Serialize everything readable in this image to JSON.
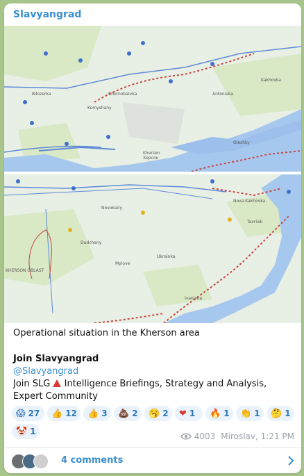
{
  "channel": {
    "name": "Slavyangrad"
  },
  "map1": {
    "labels": [
      "Kherson",
      "Херсон",
      "Antonivka",
      "Komyshany",
      "Chornobaivka",
      "Bilozerka",
      "Oleshky",
      "Kakhovka"
    ],
    "colors": {
      "water": "#a6c8ee",
      "land": "#e8efe4",
      "field": "#d5e6bd",
      "front": "#c9443f"
    }
  },
  "map2": {
    "labels": [
      "Novokairy",
      "Dudchany",
      "Mylove",
      "Nova Kakhovka",
      "Tavriisk",
      "Ukrainka",
      "Ivanivka",
      "KHERSON OBLAST"
    ],
    "colors": {
      "water": "#a6c8ee",
      "land": "#e8efe4",
      "field": "#d5e6bd",
      "front": "#c9443f"
    }
  },
  "post": {
    "caption": "Operational situation in the Kherson area",
    "join_title": "Join Slavyangrad",
    "join_handle": "@Slavyangrad",
    "join_desc_before": "Join SLG ",
    "join_desc_after": " Intelligence Briefings, Strategy and Analysis, Expert Community"
  },
  "reactions": [
    {
      "emoji": "😱",
      "count": "27"
    },
    {
      "emoji": "👍",
      "count": "12"
    },
    {
      "emoji": "👍",
      "count": "3"
    },
    {
      "emoji": "💩",
      "count": "2"
    },
    {
      "emoji": "🥱",
      "count": "2"
    },
    {
      "emoji": "❤",
      "count": "1"
    },
    {
      "emoji": "🔥",
      "count": "1"
    },
    {
      "emoji": "👏",
      "count": "1"
    },
    {
      "emoji": "🤔",
      "count": "1"
    },
    {
      "emoji": "🤡",
      "count": "1"
    }
  ],
  "meta": {
    "views": "4003",
    "author_time": "Miroslav, 1:21 PM"
  },
  "comments": {
    "label": "4 comments"
  }
}
